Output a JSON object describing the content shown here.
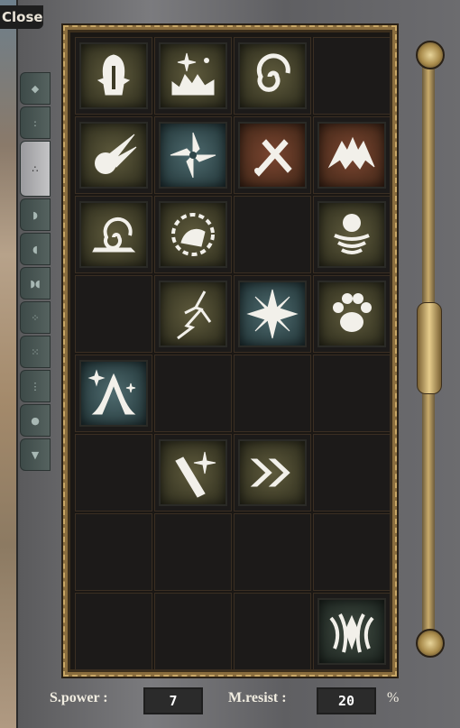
{
  "window": {
    "close_label": "Close"
  },
  "tabs": [
    {
      "icon": "one-dot-icon"
    },
    {
      "icon": "two-dot-icon"
    },
    {
      "icon": "three-dot-icon"
    },
    {
      "icon": "tab4-icon"
    },
    {
      "icon": "tab5-icon"
    },
    {
      "icon": "tab6-icon"
    },
    {
      "icon": "tab7-icon"
    },
    {
      "icon": "tab8-icon"
    },
    {
      "icon": "tab9-icon"
    },
    {
      "icon": "tab10-icon"
    },
    {
      "icon": "tab11-icon"
    }
  ],
  "skills": [
    {
      "row": 0,
      "col": 0,
      "icon": "knight-helm-icon",
      "tint": "olive"
    },
    {
      "row": 0,
      "col": 1,
      "icon": "sparkle-castle-icon",
      "tint": "olive"
    },
    {
      "row": 0,
      "col": 2,
      "icon": "swirl-icon",
      "tint": "olive"
    },
    {
      "row": 1,
      "col": 0,
      "icon": "fireball-icon",
      "tint": "olive"
    },
    {
      "row": 1,
      "col": 1,
      "icon": "shuriken-icon",
      "tint": "teal"
    },
    {
      "row": 1,
      "col": 2,
      "icon": "crossed-swords-icon",
      "tint": "red"
    },
    {
      "row": 1,
      "col": 3,
      "icon": "bat-wing-icon",
      "tint": "red"
    },
    {
      "row": 2,
      "col": 0,
      "icon": "snail-spiral-icon",
      "tint": "olive"
    },
    {
      "row": 2,
      "col": 1,
      "icon": "sun-fist-icon",
      "tint": "olive"
    },
    {
      "row": 2,
      "col": 3,
      "icon": "orb-vortex-icon",
      "tint": "olive"
    },
    {
      "row": 3,
      "col": 1,
      "icon": "lightning-icon",
      "tint": "olive"
    },
    {
      "row": 3,
      "col": 2,
      "icon": "burst-cross-icon",
      "tint": "teal"
    },
    {
      "row": 3,
      "col": 3,
      "icon": "paw-icon",
      "tint": "olive"
    },
    {
      "row": 4,
      "col": 0,
      "icon": "mountain-sparkle-icon",
      "tint": "teal"
    },
    {
      "row": 5,
      "col": 1,
      "icon": "spark-strike-icon",
      "tint": "olive"
    },
    {
      "row": 5,
      "col": 2,
      "icon": "double-chevron-icon",
      "tint": "olive"
    },
    {
      "row": 7,
      "col": 3,
      "icon": "claw-shield-icon",
      "tint": "dark"
    }
  ],
  "stats": {
    "spower_label": "S.power :",
    "spower_value": "7",
    "mresist_label": "M.resist :",
    "mresist_value": "20",
    "percent_sign": "%"
  }
}
